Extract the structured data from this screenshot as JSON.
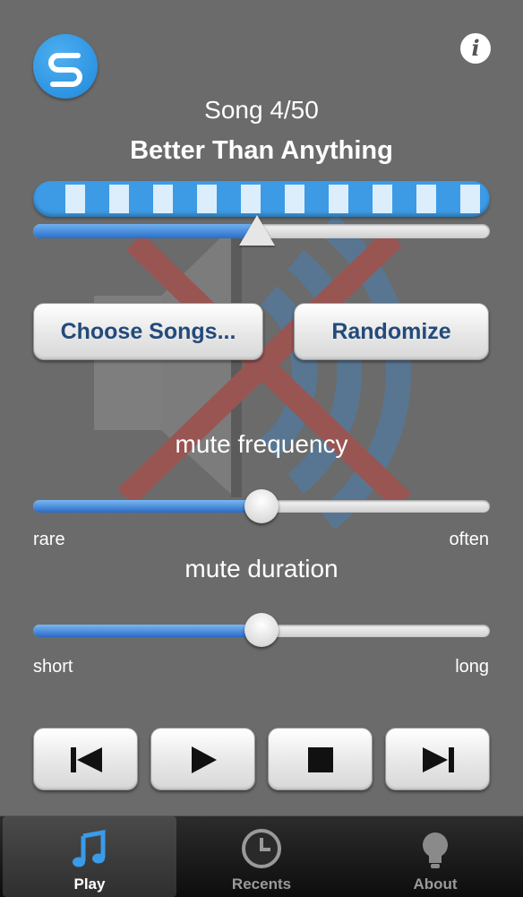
{
  "header": {
    "logo_icon": "s-logo-icon",
    "info_glyph": "i"
  },
  "song": {
    "count": "Song 4/50",
    "title": "Better Than Anything",
    "position_fraction": 0.49
  },
  "buttons": {
    "choose_songs": "Choose Songs...",
    "randomize": "Randomize"
  },
  "mute_frequency": {
    "label": "mute frequency",
    "min_label": "rare",
    "max_label": "often",
    "value_fraction": 0.5
  },
  "mute_duration": {
    "label": "mute duration",
    "min_label": "short",
    "max_label": "long",
    "value_fraction": 0.5
  },
  "transport": {
    "icons": [
      "skip-previous-icon",
      "play-icon",
      "stop-icon",
      "skip-next-icon"
    ]
  },
  "tabs": [
    {
      "label": "Play",
      "icon": "music-note-icon",
      "active": true
    },
    {
      "label": "Recents",
      "icon": "clock-icon",
      "active": false
    },
    {
      "label": "About",
      "icon": "lightbulb-icon",
      "active": false
    }
  ],
  "colors": {
    "accent_blue": "#3d9be6",
    "button_text": "#234a7b",
    "background": "#6b6b6b",
    "active_tab": "#3a9be8"
  }
}
